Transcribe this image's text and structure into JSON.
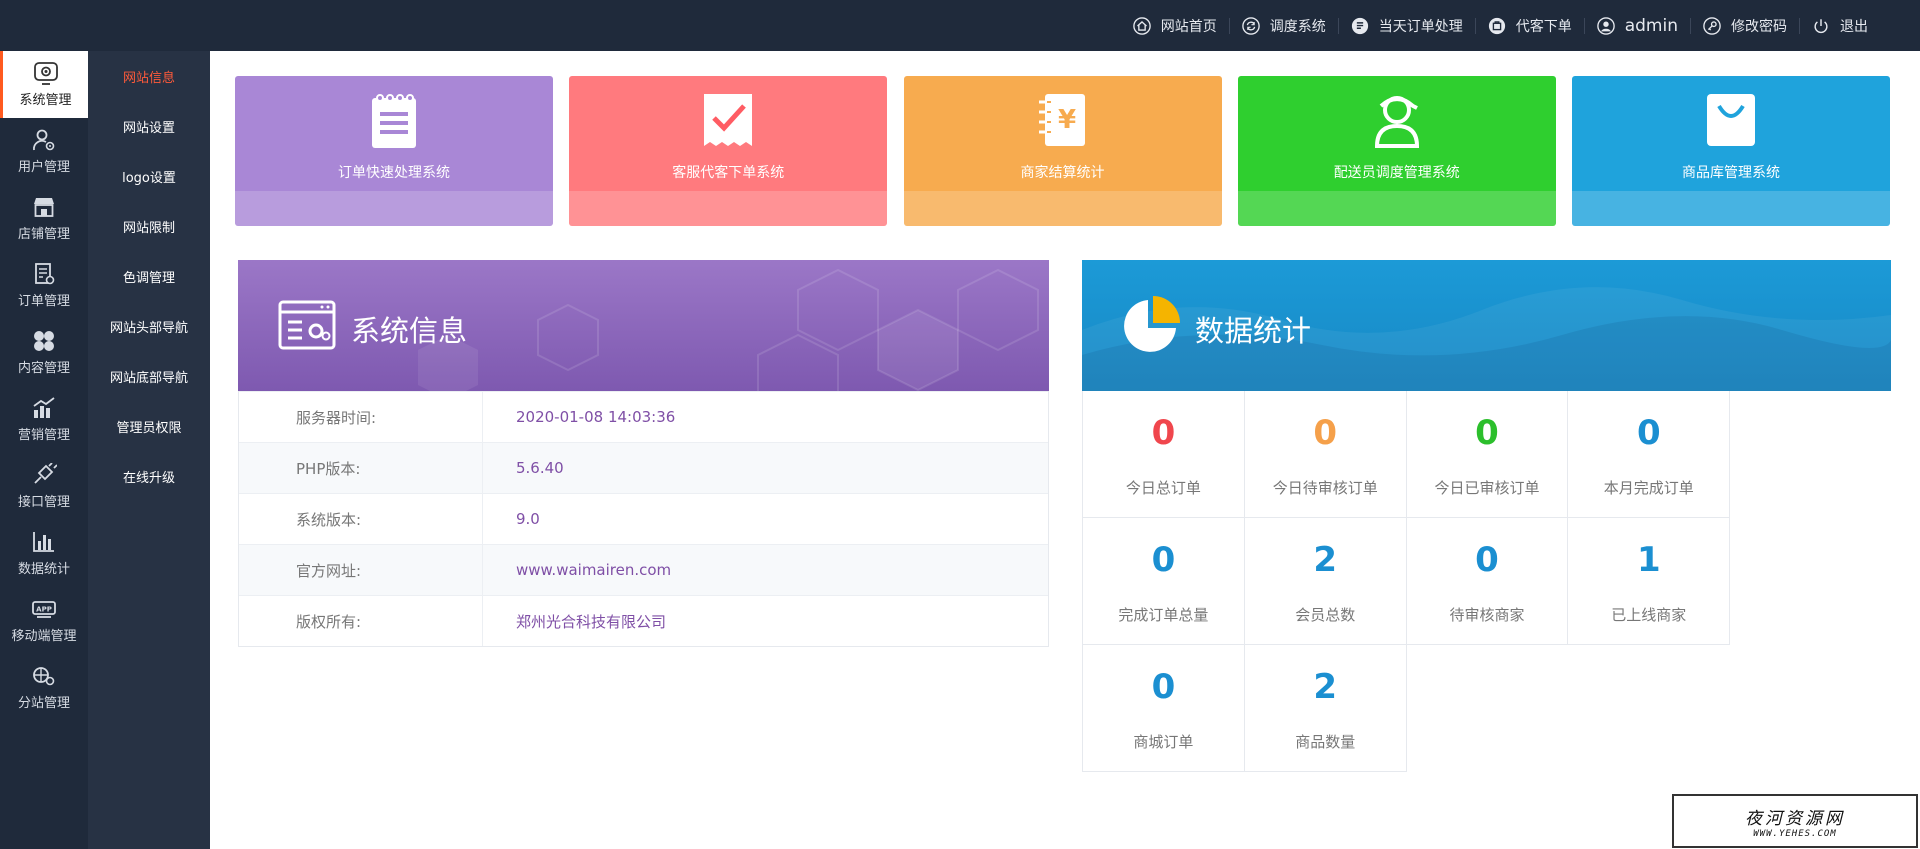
{
  "topnav": {
    "items": [
      {
        "label": "网站首页",
        "icon": "home-icon"
      },
      {
        "label": "调度系统",
        "icon": "refresh-icon"
      },
      {
        "label": "当天订单处理",
        "icon": "document-list-icon"
      },
      {
        "label": "代客下单",
        "icon": "bag-icon"
      },
      {
        "label": "admin",
        "icon": "user-icon"
      },
      {
        "label": "修改密码",
        "icon": "key-icon"
      },
      {
        "label": "退出",
        "icon": "power-icon"
      }
    ]
  },
  "sidebar": {
    "items": [
      {
        "label": "系统管理",
        "icon": "system-icon",
        "active": true
      },
      {
        "label": "用户管理",
        "icon": "user-gear-icon"
      },
      {
        "label": "店铺管理",
        "icon": "store-icon"
      },
      {
        "label": "订单管理",
        "icon": "order-icon"
      },
      {
        "label": "内容管理",
        "icon": "content-icon"
      },
      {
        "label": "营销管理",
        "icon": "marketing-icon"
      },
      {
        "label": "接口管理",
        "icon": "plug-icon"
      },
      {
        "label": "数据统计",
        "icon": "bar-chart-icon"
      },
      {
        "label": "移动端管理",
        "icon": "app-icon"
      },
      {
        "label": "分站管理",
        "icon": "branch-icon"
      }
    ]
  },
  "subnav": {
    "items": [
      {
        "label": "网站信息",
        "active": true
      },
      {
        "label": "网站设置"
      },
      {
        "label": "logo设置"
      },
      {
        "label": "网站限制"
      },
      {
        "label": "色调管理"
      },
      {
        "label": "网站头部导航"
      },
      {
        "label": "网站底部导航"
      },
      {
        "label": "管理员权限"
      },
      {
        "label": "在线升级"
      }
    ]
  },
  "cards": [
    {
      "label": "订单快速处理系统",
      "icon": "notepad-icon",
      "color": "#a987d6"
    },
    {
      "label": "客服代客下单系统",
      "icon": "checkmark-receipt-icon",
      "color": "#ff7a7e"
    },
    {
      "label": "商家结算统计",
      "icon": "yuan-notebook-icon",
      "color": "#f7ab4f"
    },
    {
      "label": "配送员调度管理系统",
      "icon": "courier-icon",
      "color": "#2fcf2f"
    },
    {
      "label": "商品库管理系统",
      "icon": "shopping-bag-icon",
      "color": "#1fa3dc"
    }
  ],
  "sysinfo": {
    "title": "系统信息",
    "rows": [
      {
        "key": "服务器时间:",
        "value": "2020-01-08 14:03:36"
      },
      {
        "key": "PHP版本:",
        "value": "5.6.40"
      },
      {
        "key": "系统版本:",
        "value": "9.0"
      },
      {
        "key": "官方网址:",
        "value": "www.waimairen.com"
      },
      {
        "key": "版权所有:",
        "value": "郑州光合科技有限公司"
      }
    ]
  },
  "stats": {
    "title": "数据统计",
    "items": [
      {
        "value": "0",
        "label": "今日总订单",
        "color": "#f0464d"
      },
      {
        "value": "0",
        "label": "今日待审核订单",
        "color": "#f5a04a"
      },
      {
        "value": "0",
        "label": "今日已审核订单",
        "color": "#2cbf2c"
      },
      {
        "value": "0",
        "label": "本月完成订单",
        "color": "#1b8fd1"
      },
      {
        "value": "0",
        "label": "完成订单总量",
        "color": "#1b8fd1"
      },
      {
        "value": "2",
        "label": "会员总数",
        "color": "#1b8fd1"
      },
      {
        "value": "0",
        "label": "待审核商家",
        "color": "#1b8fd1"
      },
      {
        "value": "1",
        "label": "已上线商家",
        "color": "#1b8fd1"
      },
      {
        "value": "0",
        "label": "商城订单",
        "color": "#1b8fd1"
      },
      {
        "value": "2",
        "label": "商品数量",
        "color": "#1b8fd1"
      }
    ]
  },
  "watermark": {
    "main": "夜河资源网",
    "sub": "WWW.YEHES.COM"
  }
}
